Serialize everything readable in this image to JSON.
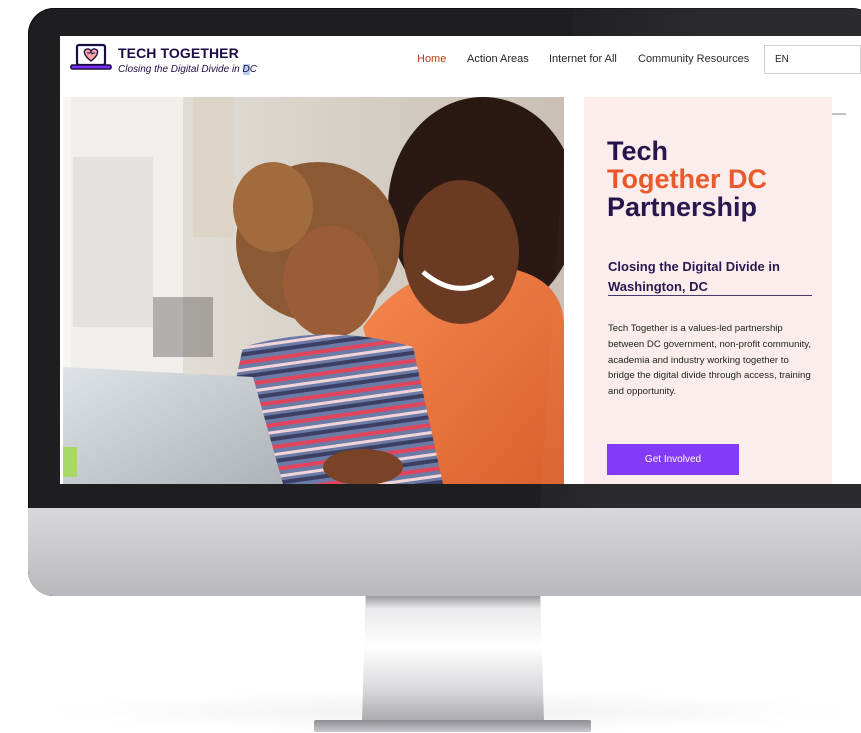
{
  "header": {
    "brand_name": "TECH TOGETHER",
    "tagline_prefix": "Closing the Digital Divide in ",
    "tagline_highlight": "D",
    "tagline_suffix": "C",
    "logo_icon": "laptop-heart-icon"
  },
  "nav": {
    "items": [
      {
        "label": "Home",
        "active": true
      },
      {
        "label": "Action Areas",
        "active": false
      },
      {
        "label": "Internet for All",
        "active": false
      },
      {
        "label": "Community Resources",
        "active": false
      }
    ],
    "language": "EN"
  },
  "hero": {
    "title_line1": "Tech",
    "title_line2": "Together DC",
    "title_line3": "Partnership",
    "subtitle": "Closing the Digital Divide in Washington, DC",
    "body": "Tech Together is a values-led partnership between DC government, non-profit community, academia and industry working together to bridge the digital divide through access, training and opportunity.",
    "cta_label": "Get Involved"
  },
  "colors": {
    "brand_navy": "#1d0b45",
    "accent_orange": "#e8501f",
    "cta_purple": "#7b2ff7",
    "panel_pink": "#fcecec",
    "nav_active": "#b33d12"
  }
}
